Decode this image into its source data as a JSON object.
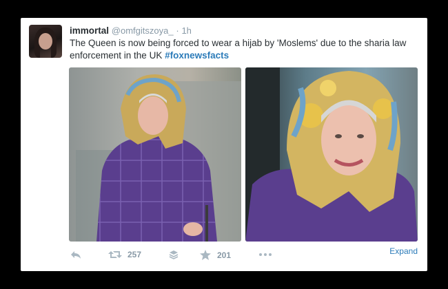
{
  "tweet": {
    "name": "immortal",
    "handle": "@omfgitszoya_",
    "separator": "·",
    "time": "1h",
    "text": "The Queen is now being forced to wear a hijab by 'Moslems' due to the sharia law enforcement in the UK ",
    "hashtag": "#foxnewsfacts"
  },
  "actions": {
    "reply_icon": "reply-icon",
    "retweet_icon": "retweet-icon",
    "retweet_count": "257",
    "buffer_icon": "stack-icon",
    "favorite_icon": "star-icon",
    "favorite_count": "201",
    "more_icon": "ellipsis-icon",
    "expand_label": "Expand"
  },
  "colors": {
    "background": "#000000",
    "card": "#ffffff",
    "link": "#2b7bb9",
    "muted": "#8899a6",
    "text": "#292f33"
  }
}
